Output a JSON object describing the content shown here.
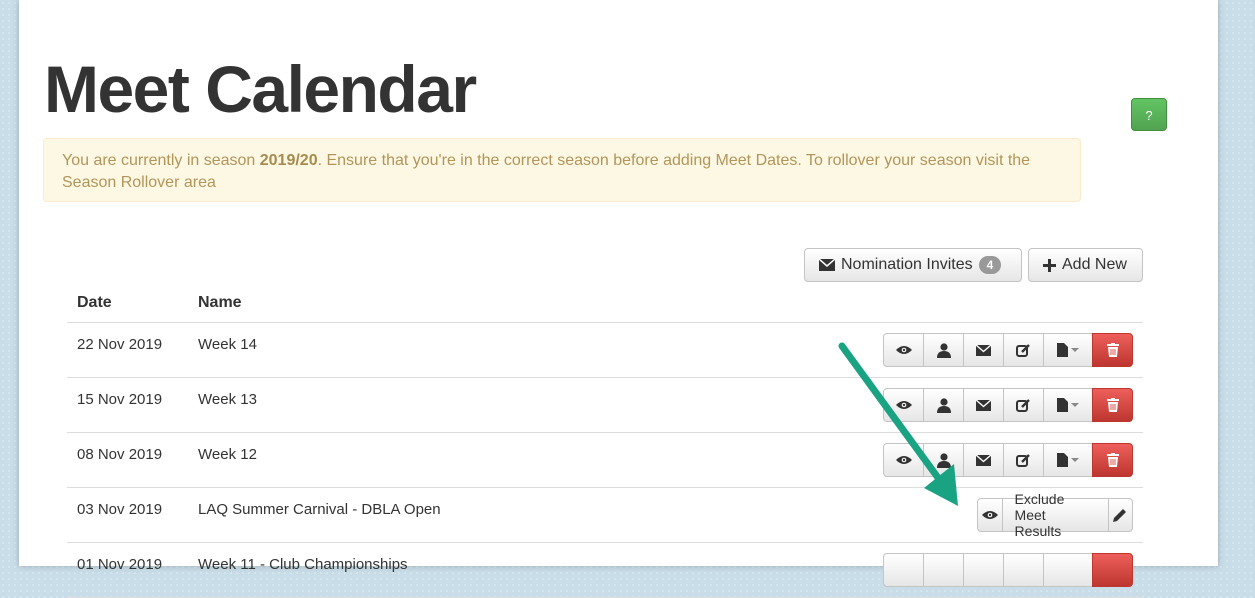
{
  "page": {
    "title": "Meet Calendar",
    "help_label": "?"
  },
  "alert": {
    "prefix": "You are currently in season ",
    "season": "2019/20",
    "suffix": ". Ensure that you're in the correct season before adding Meet Dates. To rollover your season visit the Season Rollover area"
  },
  "toolbar": {
    "nominations_label": "Nomination Invites",
    "nominations_count": "4",
    "add_new_label": "Add New"
  },
  "table": {
    "headers": {
      "date": "Date",
      "name": "Name"
    },
    "rows": [
      {
        "date": "22 Nov 2019",
        "name": "Week 14"
      },
      {
        "date": "15 Nov 2019",
        "name": "Week 13"
      },
      {
        "date": "08 Nov 2019",
        "name": "Week 12"
      },
      {
        "date": "03 Nov 2019",
        "name": "LAQ Summer Carnival - DBLA Open"
      },
      {
        "date": "01 Nov 2019",
        "name": "Week 11 - Club Championships"
      }
    ],
    "exclude_label": "Exclude Meet Results"
  },
  "icons": {
    "view": "eye-icon",
    "person": "user-icon",
    "email": "envelope-icon",
    "edit": "edit-icon",
    "file": "file-icon",
    "delete": "trash-icon",
    "pencil": "pencil-icon"
  },
  "colors": {
    "annotation_arrow": "#1aa383",
    "danger": "#d9534f",
    "help": "#5bb75b"
  }
}
